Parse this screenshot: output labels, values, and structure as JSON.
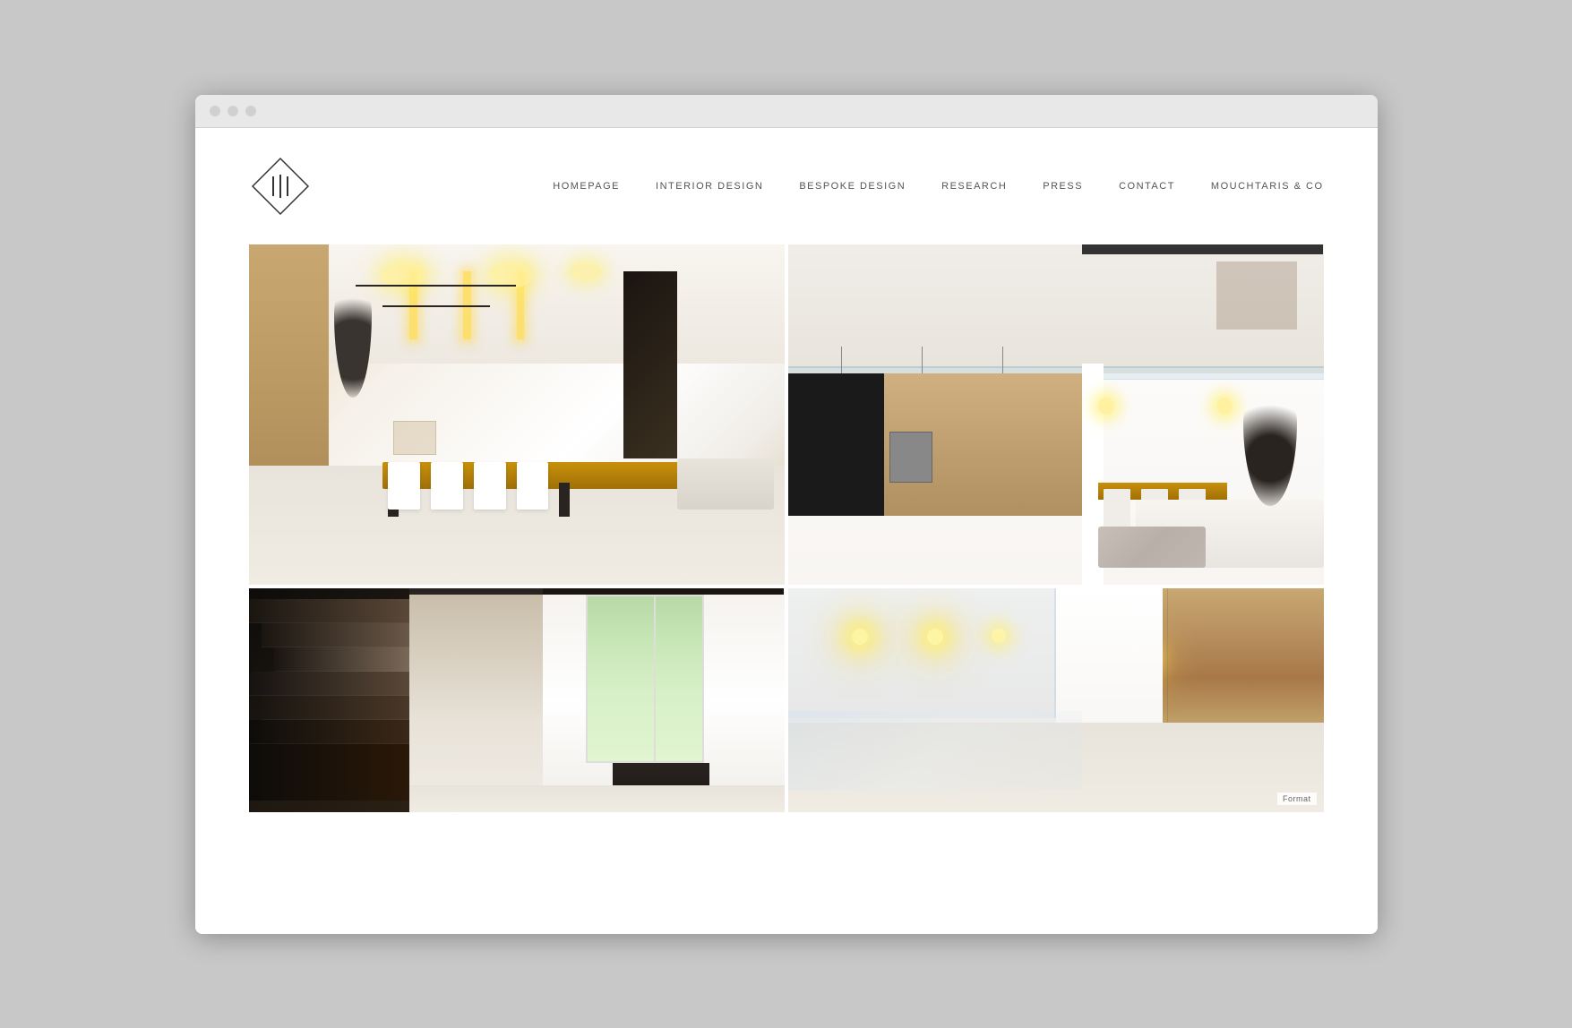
{
  "browser": {
    "dots": [
      "dot1",
      "dot2",
      "dot3"
    ]
  },
  "header": {
    "logo_text": "111",
    "nav_items": [
      {
        "id": "homepage",
        "label": "HOMEPAGE"
      },
      {
        "id": "interior-design",
        "label": "INTERIOR DESIGN"
      },
      {
        "id": "bespoke-design",
        "label": "BESPOKE DESIGN"
      },
      {
        "id": "research",
        "label": "RESEARCH"
      },
      {
        "id": "press",
        "label": "PRESS"
      },
      {
        "id": "contact",
        "label": "CONTACT"
      },
      {
        "id": "mouchtaris",
        "label": "MOUCHTARIS & CO"
      }
    ]
  },
  "gallery": {
    "images": [
      {
        "id": "room1",
        "alt": "Modern living and dining area with wooden table and pendant lights"
      },
      {
        "id": "room2",
        "alt": "Open plan kitchen and dining area with mezzanine"
      },
      {
        "id": "room3",
        "alt": "Minimalist staircase with natural light"
      },
      {
        "id": "room4",
        "alt": "Interior ceiling detail with recessed lighting and wood panels"
      }
    ],
    "format_badge": "Format"
  }
}
